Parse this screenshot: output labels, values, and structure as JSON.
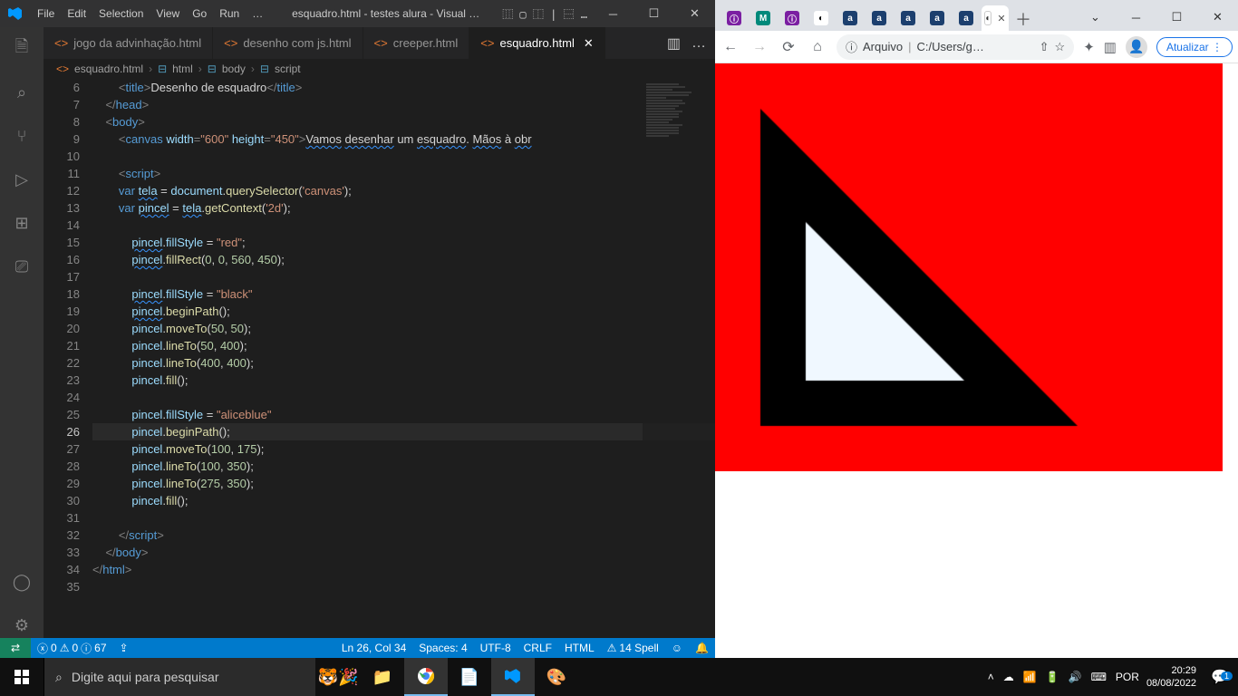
{
  "vscode": {
    "menus": [
      "File",
      "Edit",
      "Selection",
      "View",
      "Go",
      "Run"
    ],
    "menuDots": "…",
    "title": "esquadro.html - testes alura - Visual …",
    "layoutGlyphs": "⿲ ▢ ⿰ | ⿱ …",
    "tabs": [
      {
        "label": "jogo da advinhação.html",
        "active": false
      },
      {
        "label": "desenho com js.html",
        "active": false
      },
      {
        "label": "creeper.html",
        "active": false
      },
      {
        "label": "esquadro.html",
        "active": true
      }
    ],
    "breadcrumb": [
      "esquadro.html",
      "html",
      "body",
      "script"
    ],
    "gutter": {
      "start": 6,
      "end": 35,
      "current": 26
    },
    "status": {
      "errors": "0",
      "warnings": "0",
      "info": "67",
      "lncol": "Ln 26, Col 34",
      "spaces": "Spaces: 4",
      "enc": "UTF-8",
      "eol": "CRLF",
      "lang": "HTML",
      "spell": "14 Spell"
    }
  },
  "code": {
    "l6": "        <title>Desenho de esquadro</title>",
    "l7": "    </head>",
    "l8": "    <body>",
    "l9": "        <canvas width=\"600\" height=\"450\">Vamos desenhar um esquadro. Mãos à obr",
    "l10": "",
    "l11": "        <script>",
    "l12": "        var tela = document.querySelector('canvas');",
    "l13": "        var pincel = tela.getContext('2d');",
    "l14": "",
    "l15": "            pincel.fillStyle = \"red\";",
    "l16": "            pincel.fillRect(0, 0, 560, 450);",
    "l17": "",
    "l18": "            pincel.fillStyle = \"black\"",
    "l19": "            pincel.beginPath();",
    "l20": "            pincel.moveTo(50, 50);",
    "l21": "            pincel.lineTo(50, 400);",
    "l22": "            pincel.lineTo(400, 400);",
    "l23": "            pincel.fill();",
    "l24": "",
    "l25": "            pincel.fillStyle = \"aliceblue\"",
    "l26": "            pincel.beginPath();",
    "l27": "            pincel.moveTo(100, 175);",
    "l28": "            pincel.lineTo(100, 350);",
    "l29": "            pincel.lineTo(275, 350);",
    "l30": "            pincel.fill();",
    "l31": "",
    "l32": "        </script>",
    "l33": "    </body>",
    "l34": "</html>"
  },
  "browser": {
    "iconTabs": [
      {
        "bg": "#7b1fa2",
        "txt": "ⓘ"
      },
      {
        "bg": "#00897b",
        "txt": "M"
      },
      {
        "bg": "#7b1fa2",
        "txt": "ⓘ"
      },
      {
        "bg": "#fff",
        "txt": "◐",
        "fg": "#000"
      },
      {
        "bg": "#1c3f6e",
        "txt": "a"
      },
      {
        "bg": "#1c3f6e",
        "txt": "a"
      },
      {
        "bg": "#1c3f6e",
        "txt": "a"
      },
      {
        "bg": "#1c3f6e",
        "txt": "a"
      },
      {
        "bg": "#1c3f6e",
        "txt": "a"
      }
    ],
    "addrLabel": "Arquivo",
    "addrPath": "C:/Users/g…",
    "update": "Atualizar"
  },
  "taskbar": {
    "searchPlaceholder": "Digite aqui para pesquisar",
    "lang": "POR",
    "time": "20:29",
    "date": "08/08/2022",
    "notif": "1"
  }
}
